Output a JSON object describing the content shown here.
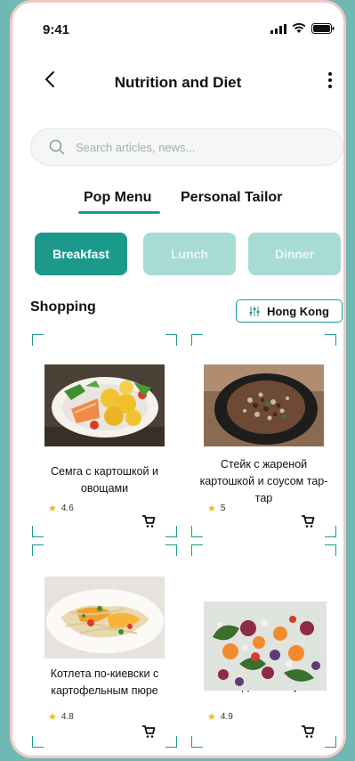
{
  "status_bar": {
    "time": "9:41"
  },
  "header": {
    "title": "Nutrition and Diet"
  },
  "search": {
    "placeholder": "Search articles, news..."
  },
  "tabs": [
    {
      "label": "Pop Menu",
      "active": true
    },
    {
      "label": "Personal Tailor",
      "active": false
    }
  ],
  "meals": [
    {
      "label": "Breakfast",
      "active": true
    },
    {
      "label": "Lunch",
      "active": false
    },
    {
      "label": "Dinner",
      "active": false
    }
  ],
  "section": {
    "title": "Shopping"
  },
  "location": {
    "label": "Hong Kong"
  },
  "dishes": [
    {
      "name": "Семга с картошкой и овощами",
      "rating": "4.6"
    },
    {
      "name": "Стейк с жареной картошкой и соусом тар-тар",
      "rating": "5"
    },
    {
      "name": "Котлета по-киевски с картофельным пюре",
      "rating": "4.8"
    },
    {
      "name": "елем фри и кетчупом",
      "rating": "4.9"
    }
  ],
  "colors": {
    "accent": "#1b9a8c",
    "accent_light": "#a9dbd5",
    "background": "#6fb8b3"
  }
}
